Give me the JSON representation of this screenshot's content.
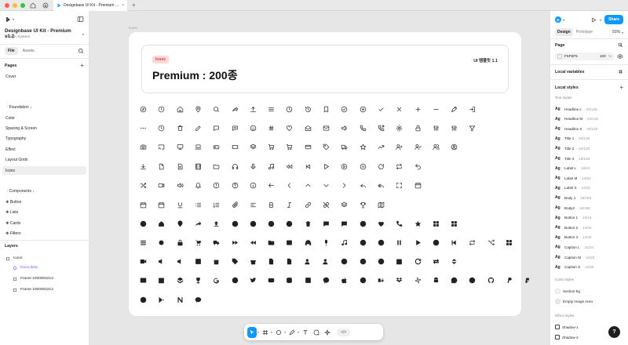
{
  "window": {
    "tab_title": "Designbase UI Kit - Premium v1.",
    "new_tab": "+",
    "lights": [
      "#fe5f57",
      "#febc2e",
      "#28c840"
    ]
  },
  "left": {
    "project_title": "Designbase UI Kit - Premium v1.2",
    "project_sub": "Design System",
    "tabs": [
      "File",
      "Assets"
    ],
    "pages_title": "Pages",
    "pages": [
      "Cover",
      "ㆍFoundation ↓",
      "Color",
      "Spacing & Screen",
      "Typography",
      "Effect",
      "Layout Grids",
      "Icons",
      "ㆍComponents ↓",
      "❖ Button",
      "❖ Lists",
      "❖ Cards",
      "❖ Filters"
    ],
    "selected_page": 7,
    "layers_title": "Layers",
    "layers": [
      "Icons",
      "Docs-desc",
      "Frame 1000002213",
      "Frame 1000002214"
    ]
  },
  "canvas": {
    "frame_label": "Icons",
    "badge": "Icons",
    "heading": "Premium : 200종",
    "version": "UI 템플릿 1.1",
    "icon_rows": [
      [
        "compass",
        "clock-dash",
        "home",
        "pin",
        "search",
        "share",
        "upload",
        "menu",
        "clock",
        "history",
        "bookmark",
        "check-circle",
        "plus-circle",
        "check",
        "close",
        "plus",
        "minus",
        "pencil",
        "login"
      ],
      [
        "more",
        "clock-dash",
        "trash",
        "edit",
        "chat",
        "chat-dots",
        "smile",
        "hash",
        "heart",
        "mail-open",
        "mail",
        "megaphone",
        "phone",
        "phone-out",
        "gear",
        "lock",
        "sliders",
        "sliders",
        "filter"
      ],
      [
        "camera",
        "cast",
        "monitor",
        "laptop",
        "gamepad",
        "ticket",
        "layers",
        "cart",
        "cart",
        "card",
        "tag",
        "truck",
        "star",
        "trend",
        "user-plus",
        "user-check",
        "users",
        "user-circle"
      ],
      [
        "download",
        "file",
        "file-text",
        "film",
        "folder",
        "headphones",
        "mic",
        "music",
        "play-back",
        "skip-back",
        "play",
        "play-circle",
        "pause-circle",
        "refresh",
        "repeat",
        "undo"
      ],
      [
        "shuffle",
        "video",
        "volume",
        "bell",
        "alert",
        "help",
        "info",
        "arrow-left",
        "chevron-left",
        "chevron-up",
        "chevron-down",
        "chevron-right",
        "reply",
        "reply-all",
        "expand",
        "calendar"
      ],
      [
        "calendar",
        "calendar",
        "underline",
        "list",
        "list-ordered",
        "paperclip",
        "align",
        "bold",
        "italic",
        "link",
        "unlink",
        "layers",
        "trophy",
        "map"
      ],
      [
        "compass-f",
        "home-f",
        "pin-f",
        "share-f",
        "upload-f",
        "clock-f",
        "check-f",
        "clock-f",
        "close-f",
        "trash-f",
        "chat-f",
        "chat-f",
        "smile-f",
        "heart-f",
        "phone-f",
        "star-f",
        "grid-f",
        "grid-f"
      ],
      [
        "sliders-f",
        "gear-f",
        "lock-f",
        "cart-f",
        "truck-f",
        "forward-f",
        "rewind-f",
        "folder-f",
        "image-f",
        "headphones-f",
        "mic-f",
        "music-f",
        "user-f",
        "user-f",
        "pause-f",
        "play-f",
        "play-circle-f",
        "skip-f",
        "repeat-f",
        "shuffle-f",
        "grid-f"
      ],
      [
        "video-f",
        "volume-f",
        "mute-f",
        "film-f",
        "bag-f",
        "tag-f",
        "gift-f",
        "doc-f",
        "doc-f",
        "user-plus-f",
        "user-check-f",
        "help-f",
        "info-f",
        "alert-f",
        "calendar-f",
        "refresh-f",
        "switch-f",
        "collapse-f"
      ],
      [
        "gallery-f",
        "calendar-f",
        "layers-f",
        "trophy-f",
        "google",
        "facebook",
        "twitter",
        "youtube",
        "instagram",
        "linkedin",
        "messenger",
        "apple",
        "pinterest",
        "behance",
        "dropbox",
        "slack",
        "android",
        "whatsapp",
        "spotify",
        "github",
        "paypal",
        "paypal2"
      ],
      [
        "safari",
        "play-store",
        "notion",
        "chat-bubble-f"
      ]
    ]
  },
  "toolbar": {
    "code_label": "</>"
  },
  "right": {
    "avatar": "D",
    "share": "Share",
    "tabs": [
      "Design",
      "Prototype"
    ],
    "zoom": "91%",
    "page_title": "Page",
    "page_color": "F5F5F5",
    "page_opacity": "100",
    "page_pct": "%",
    "local_variables": "Local variables",
    "local_styles": "Local styles",
    "text_styles_title": "Text styles",
    "text_styles": [
      {
        "name": "Headline L",
        "meta": "· 26/125"
      },
      {
        "name": "Headline M",
        "meta": "· 22/125"
      },
      {
        "name": "Headline S",
        "meta": "· 20/125"
      },
      {
        "name": "Title 1",
        "meta": "· 24/125"
      },
      {
        "name": "Title 2",
        "meta": "· 20/125"
      },
      {
        "name": "Title 3",
        "meta": "· 18/125"
      },
      {
        "name": "Label L",
        "meta": "· 16/24"
      },
      {
        "name": "Label M",
        "meta": "· 14/20"
      },
      {
        "name": "Label S",
        "meta": "· 12/20"
      },
      {
        "name": "Body 1",
        "meta": "· 18/160"
      },
      {
        "name": "Body2",
        "meta": "· 16/160"
      },
      {
        "name": "Button 1",
        "meta": "· 16/24"
      },
      {
        "name": "Button 2",
        "meta": "· 14/20"
      },
      {
        "name": "Button 3",
        "meta": "· 12/20"
      },
      {
        "name": "Caption L",
        "meta": "· 16/24"
      },
      {
        "name": "Caption M",
        "meta": "· 14/20"
      },
      {
        "name": "Caption S",
        "meta": "· 12/20"
      }
    ],
    "color_styles_title": "Color styles",
    "color_styles": [
      {
        "name": "Section-bg",
        "color": "#f5f5f5"
      },
      {
        "name": "Empty Image Area",
        "color": "#e8e8e8"
      }
    ],
    "effect_styles_title": "Effect styles",
    "effect_styles": [
      "Shadow-1",
      "Shadow-2"
    ],
    "help": "?"
  }
}
